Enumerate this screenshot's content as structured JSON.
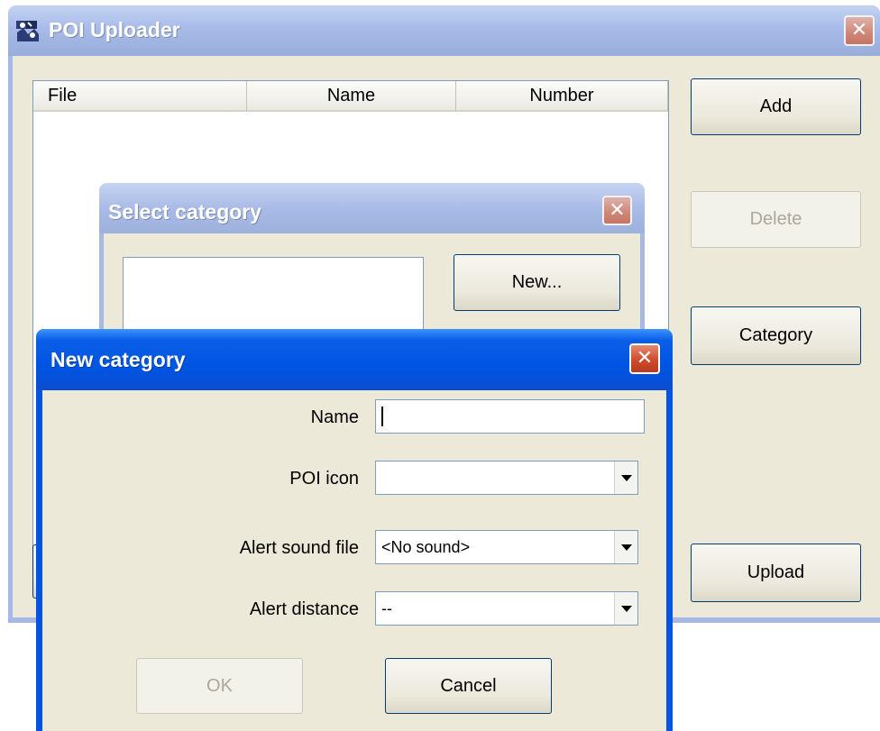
{
  "main_window": {
    "title": "POI Uploader",
    "close_glyph": "✕",
    "columns": [
      "File",
      "Name",
      "Number"
    ],
    "buttons": {
      "add": "Add",
      "delete": "Delete",
      "category": "Category",
      "upload": "Upload"
    }
  },
  "select_category": {
    "title": "Select category",
    "close_glyph": "✕",
    "new_button": "New..."
  },
  "new_category": {
    "title": "New category",
    "close_glyph": "✕",
    "name_label": "Name",
    "name_value": "",
    "poi_icon_label": "POI icon",
    "poi_icon_value": "",
    "alert_sound_label": "Alert sound file",
    "alert_sound_value": "<No sound>",
    "alert_distance_label": "Alert distance",
    "alert_distance_value": "--",
    "ok_button": "OK",
    "cancel_button": "Cancel"
  },
  "colors": {
    "active_titlebar": "#0054e3",
    "inactive_titlebar": "#a6b8e6",
    "dialog_face": "#ece9d8"
  }
}
